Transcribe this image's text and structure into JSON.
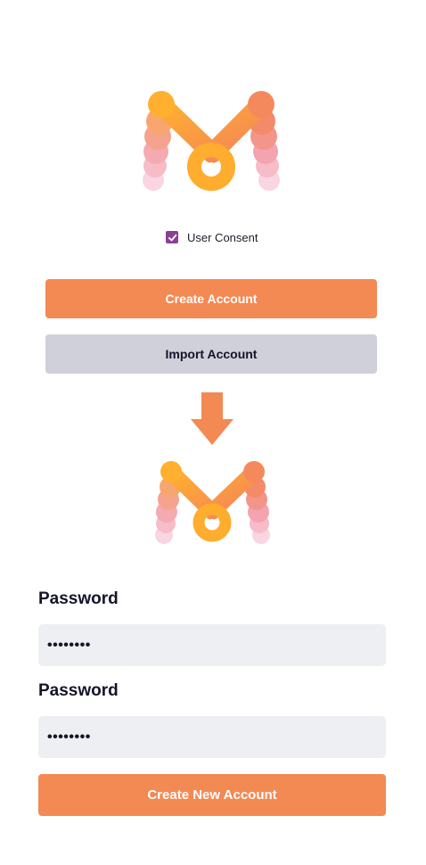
{
  "consent": {
    "label": "User Consent",
    "checked": true,
    "checkbox_color": "#8c3f97"
  },
  "buttons": {
    "create_account": "Create Account",
    "import_account": "Import Account",
    "create_new_account": "Create New Account"
  },
  "form": {
    "fields": [
      {
        "label": "Password",
        "value": "••••••••"
      },
      {
        "label": "Password",
        "value": "••••••••"
      }
    ]
  },
  "icons": {
    "logo": "m-logo-icon",
    "arrow": "arrow-down-icon",
    "checkmark": "checkmark-icon"
  },
  "colors": {
    "primary": "#f38953",
    "secondary": "#cfd0d9",
    "field_background": "#eeeff2",
    "text_dark": "#14142b"
  }
}
